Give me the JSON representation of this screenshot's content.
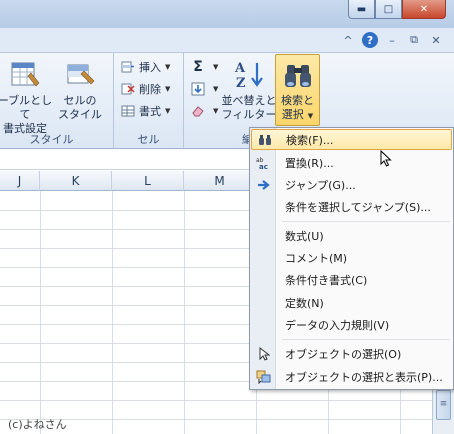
{
  "window": {
    "minimize_glyph": "▬",
    "maximize_glyph": "□",
    "close_glyph": "✕"
  },
  "ribbon_tools": {
    "collapse_glyph": "^",
    "help_glyph": "?",
    "minimize_glyph": "–",
    "restore_glyph": "⧉",
    "close_glyph": "✕"
  },
  "ribbon": {
    "styles_group": {
      "table_format_label_line1": "ーブルとして",
      "table_format_label_line2": "書式設定",
      "cell_styles_label_line1": "セルの",
      "cell_styles_label_line2": "スタイル",
      "group_label": "スタイル"
    },
    "cells_group": {
      "insert_label": "挿入",
      "delete_label": "削除",
      "format_label": "書式",
      "group_label": "セル"
    },
    "editing_group": {
      "sort_filter_line1": "並べ替えと",
      "sort_filter_line2": "フィルター",
      "find_select_line1": "検索と",
      "find_select_line2": "選択",
      "group_label_partial": "編"
    }
  },
  "sheet": {
    "columns": [
      "J",
      "K",
      "L",
      "M"
    ]
  },
  "menu": {
    "items": [
      {
        "label": "検索(F)...",
        "icon": "binoculars-icon",
        "highlighted": true
      },
      {
        "label": "置換(R)...",
        "icon": "replace-icon"
      },
      {
        "label": "ジャンプ(G)...",
        "icon": "arrow-right-icon"
      },
      {
        "label": "条件を選択してジャンプ(S)...",
        "icon": ""
      },
      {
        "label": "数式(U)",
        "icon": ""
      },
      {
        "label": "コメント(M)",
        "icon": ""
      },
      {
        "label": "条件付き書式(C)",
        "icon": ""
      },
      {
        "label": "定数(N)",
        "icon": ""
      },
      {
        "label": "データの入力規則(V)",
        "icon": ""
      },
      {
        "label": "オブジェクトの選択(O)",
        "icon": "pointer-icon"
      },
      {
        "label": "オブジェクトの選択と表示(P)...",
        "icon": "selection-pane-icon"
      }
    ]
  },
  "credit": "(c)よねさん",
  "colors": {
    "highlight_border": "#e3a447",
    "ribbon_bg": "#dfe9f5",
    "close_button": "#c8472c"
  }
}
